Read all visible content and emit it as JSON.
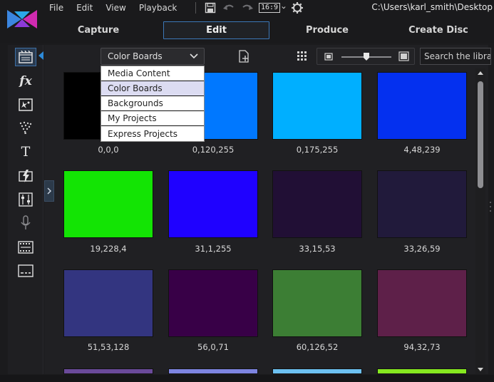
{
  "menu": {
    "items": [
      "File",
      "Edit",
      "View",
      "Playback"
    ],
    "aspect_ratio": "16:9",
    "path": "C:\\Users\\karl_smith\\Desktop"
  },
  "modes": {
    "capture": "Capture",
    "edit": "Edit",
    "produce": "Produce",
    "create_disc": "Create Disc"
  },
  "library": {
    "dropdown_value": "Color Boards",
    "dropdown_options": [
      {
        "label": "Media Content",
        "selected": false
      },
      {
        "label": "Color Boards",
        "selected": true
      },
      {
        "label": "Backgrounds",
        "selected": false
      },
      {
        "label": "My Projects",
        "selected": false
      },
      {
        "label": "Express Projects",
        "selected": false
      }
    ],
    "search_placeholder": "Search the library"
  },
  "left_panel": {
    "tools": [
      "media-room-icon",
      "fx-icon",
      "pip-icon",
      "particle-icon",
      "title-icon",
      "transition-icon",
      "audio-mixing-icon",
      "voiceover-icon",
      "chapter-icon",
      "subtitle-icon"
    ]
  },
  "color_boards": [
    {
      "label": "0,0,0",
      "color": "#000000"
    },
    {
      "label": "0,120,255",
      "color": "#0078ff"
    },
    {
      "label": "0,175,255",
      "color": "#00afff"
    },
    {
      "label": "4,48,239",
      "color": "#0430ef"
    },
    {
      "label": "19,228,4",
      "color": "#13e404"
    },
    {
      "label": "31,1,255",
      "color": "#1f01ff"
    },
    {
      "label": "33,15,53",
      "color": "#210f35"
    },
    {
      "label": "33,26,59",
      "color": "#211a3b"
    },
    {
      "label": "51,53,128",
      "color": "#333580"
    },
    {
      "label": "56,0,71",
      "color": "#380047"
    },
    {
      "label": "60,126,52",
      "color": "#3c7e34"
    },
    {
      "label": "94,32,73",
      "color": "#5e2049"
    },
    {
      "color": "#6a4a9a"
    },
    {
      "color": "#7d84e0"
    },
    {
      "color": "#6cc0f0"
    },
    {
      "color": "#86e820"
    }
  ]
}
